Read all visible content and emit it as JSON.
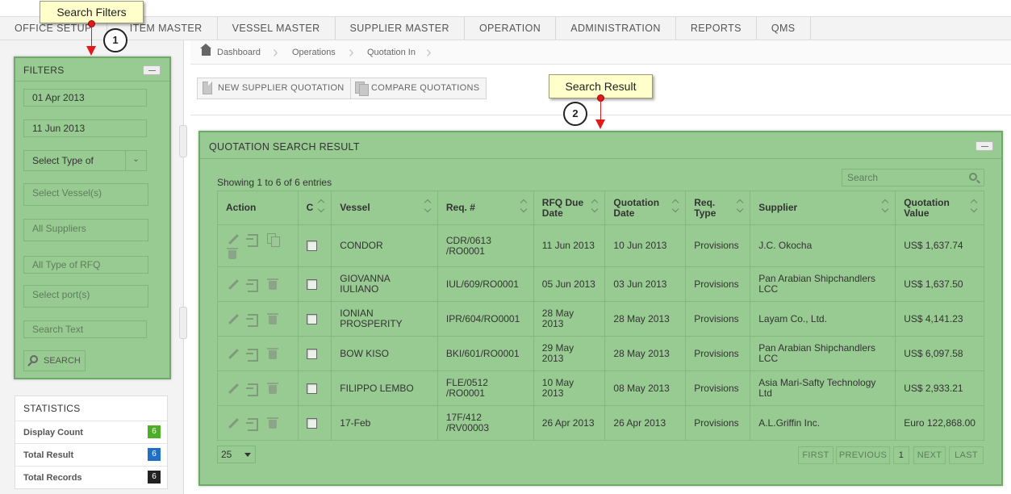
{
  "menu": [
    "OFFICE SETUP",
    "ITEM MASTER",
    "VESSEL MASTER",
    "SUPPLIER MASTER",
    "OPERATION",
    "ADMINISTRATION",
    "REPORTS",
    "QMS"
  ],
  "filters": {
    "title": "FILTERS",
    "from_date": "01 Apr 2013",
    "to_date": "11 Jun 2013",
    "type_select": "Select Type of",
    "vessel_placeholder": "Select Vessel(s)",
    "suppliers_placeholder": "All Suppliers",
    "rfq_type_placeholder": "All Type of RFQ",
    "port_placeholder": "Select port(s)",
    "search_text_placeholder": "Search Text",
    "search_button": "SEARCH"
  },
  "statistics": {
    "title": "STATISTICS",
    "rows": [
      {
        "label": "Display Count",
        "value": "6",
        "color": "#4caf27"
      },
      {
        "label": "Total Result",
        "value": "6",
        "color": "#1f6fc9"
      },
      {
        "label": "Total Records",
        "value": "6",
        "color": "#222222"
      }
    ]
  },
  "breadcrumb": [
    "Dashboard",
    "Operations",
    "Quotation In"
  ],
  "toolbar": {
    "new_quotation": "NEW SUPPLIER QUOTATION",
    "compare": "COMPARE QUOTATIONS"
  },
  "result": {
    "title": "QUOTATION SEARCH RESULT",
    "showing": "Showing 1 to 6 of 6 entries",
    "search_placeholder": "Search",
    "columns": [
      "Action",
      "C",
      "Vessel",
      "Req. #",
      "RFQ Due Date",
      "Quotation Date",
      "Req. Type",
      "Supplier",
      "Quotation Value"
    ],
    "rows": [
      {
        "vessel": "CONDOR",
        "req": "CDR/0613 /RO0001",
        "due": "11 Jun 2013",
        "qdate": "10 Jun 2013",
        "type": "Provisions",
        "supplier": "J.C. Okocha",
        "value": "US$ 1,637.74"
      },
      {
        "vessel": "GIOVANNA IULIANO",
        "req": "IUL/609/RO0001",
        "due": "05 Jun 2013",
        "qdate": "03 Jun 2013",
        "type": "Provisions",
        "supplier": "Pan Arabian Shipchandlers LCC",
        "value": "US$ 1,637.50"
      },
      {
        "vessel": "IONIAN PROSPERITY",
        "req": "IPR/604/RO0001",
        "due": "28 May 2013",
        "qdate": "28 May 2013",
        "type": "Provisions",
        "supplier": "Layam Co., Ltd.",
        "value": "US$ 4,141.23"
      },
      {
        "vessel": "BOW KISO",
        "req": "BKI/601/RO0001",
        "due": "29 May 2013",
        "qdate": "28 May 2013",
        "type": "Provisions",
        "supplier": "Pan Arabian Shipchandlers LCC",
        "value": "US$ 6,097.58"
      },
      {
        "vessel": "FILIPPO LEMBO",
        "req": "FLE/0512 /RO0001",
        "due": "10 May 2013",
        "qdate": "08 May 2013",
        "type": "Provisions",
        "supplier": "Asia Mari-Safty Technology Ltd",
        "value": "US$ 2,933.21"
      },
      {
        "vessel": "17-Feb",
        "req": "17F/412 /RV00003",
        "due": "26 Apr 2013",
        "qdate": "26 Apr 2013",
        "type": "Provisions",
        "supplier": "A.L.Griffin Inc.",
        "value": "Euro 122,868.00"
      }
    ],
    "page_size": "25",
    "pager": {
      "first": "FIRST",
      "previous": "PREVIOUS",
      "current": "1",
      "next": "NEXT",
      "last": "LAST"
    }
  },
  "callouts": {
    "filters_label": "Search Filters",
    "filters_step": "1",
    "result_label": "Search Result",
    "result_step": "2"
  },
  "colors": {
    "highlight": "#98cb92",
    "highlight_border": "#6fa86a",
    "callout_bg": "#ffffcc",
    "pin": "#e01b1b"
  }
}
